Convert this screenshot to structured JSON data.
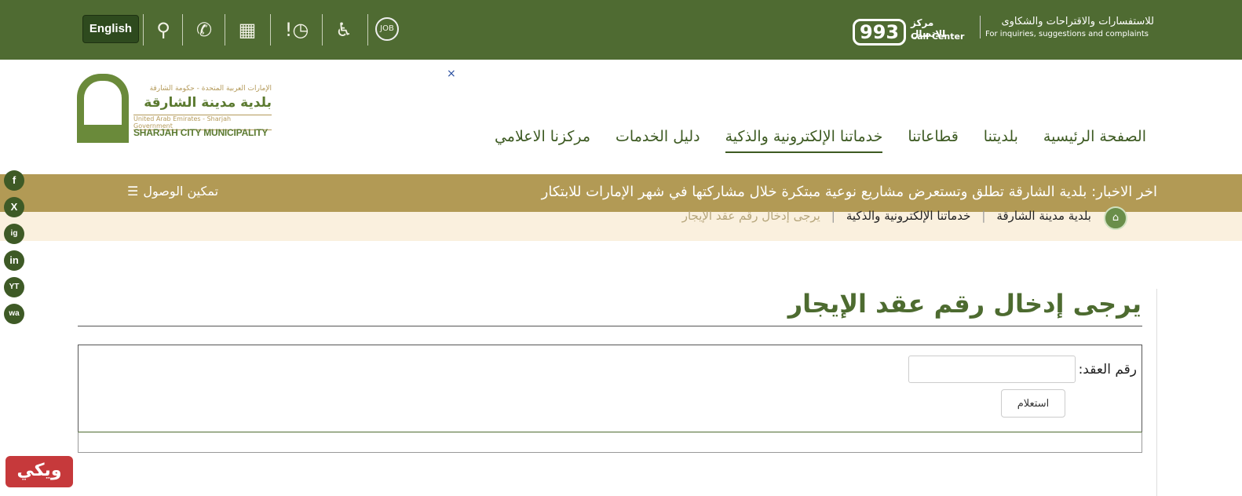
{
  "topbar": {
    "english_label": "English",
    "icons": [
      "search-icon",
      "phone-icon",
      "sitemap-icon",
      "complaint-clock-icon",
      "accessibility-icon",
      "job-search-icon"
    ],
    "call_center": {
      "number": "993",
      "ar": "مركز الاتصال",
      "en": "Call Center"
    },
    "complaints": {
      "ar": "للاستفسارات والاقتراحات والشكاوى",
      "en": "For inquiries, suggestions and complaints"
    }
  },
  "logo": {
    "line1": "الإمارات العربية المتحدة - حكومة الشارقة",
    "line2": "بلدية مدينة الشارقة",
    "line3": "United Arab Emirates - Sharjah Government",
    "line4": "SHARJAH CITY MUNICIPALITY"
  },
  "close_label": "×",
  "nav": [
    "الصفحة الرئيسية",
    "بلديتنا",
    "قطاعاتنا",
    "خدماتنا الإلكترونية والذكية",
    "دليل الخدمات",
    "مركزنا الاعلامي"
  ],
  "news": {
    "text": "اخر الاخبار:  بلدية الشارقة تطلق وتستعرض مشاريع نوعية مبتكرة خلال مشاركتها في شهر الإمارات للابتكار",
    "accessibility": "تمكين الوصول"
  },
  "breadcrumb": [
    "بلدية مدينة الشارقة",
    "خدماتنا الإلكترونية والذكية",
    "يرجى إدخال رقم عقد الإيجار"
  ],
  "social": [
    "f",
    "X",
    "ig",
    "in",
    "YT",
    "wa"
  ],
  "page": {
    "title": "يرجى إدخال رقم عقد الإيجار",
    "field_label": "رقم العقد:",
    "field_value": "",
    "submit": "استعلام"
  },
  "badge": "ويكي",
  "colors": {
    "primary": "#4f6b32",
    "news": "#b29a55",
    "crumb_bg": "#faf0de"
  }
}
